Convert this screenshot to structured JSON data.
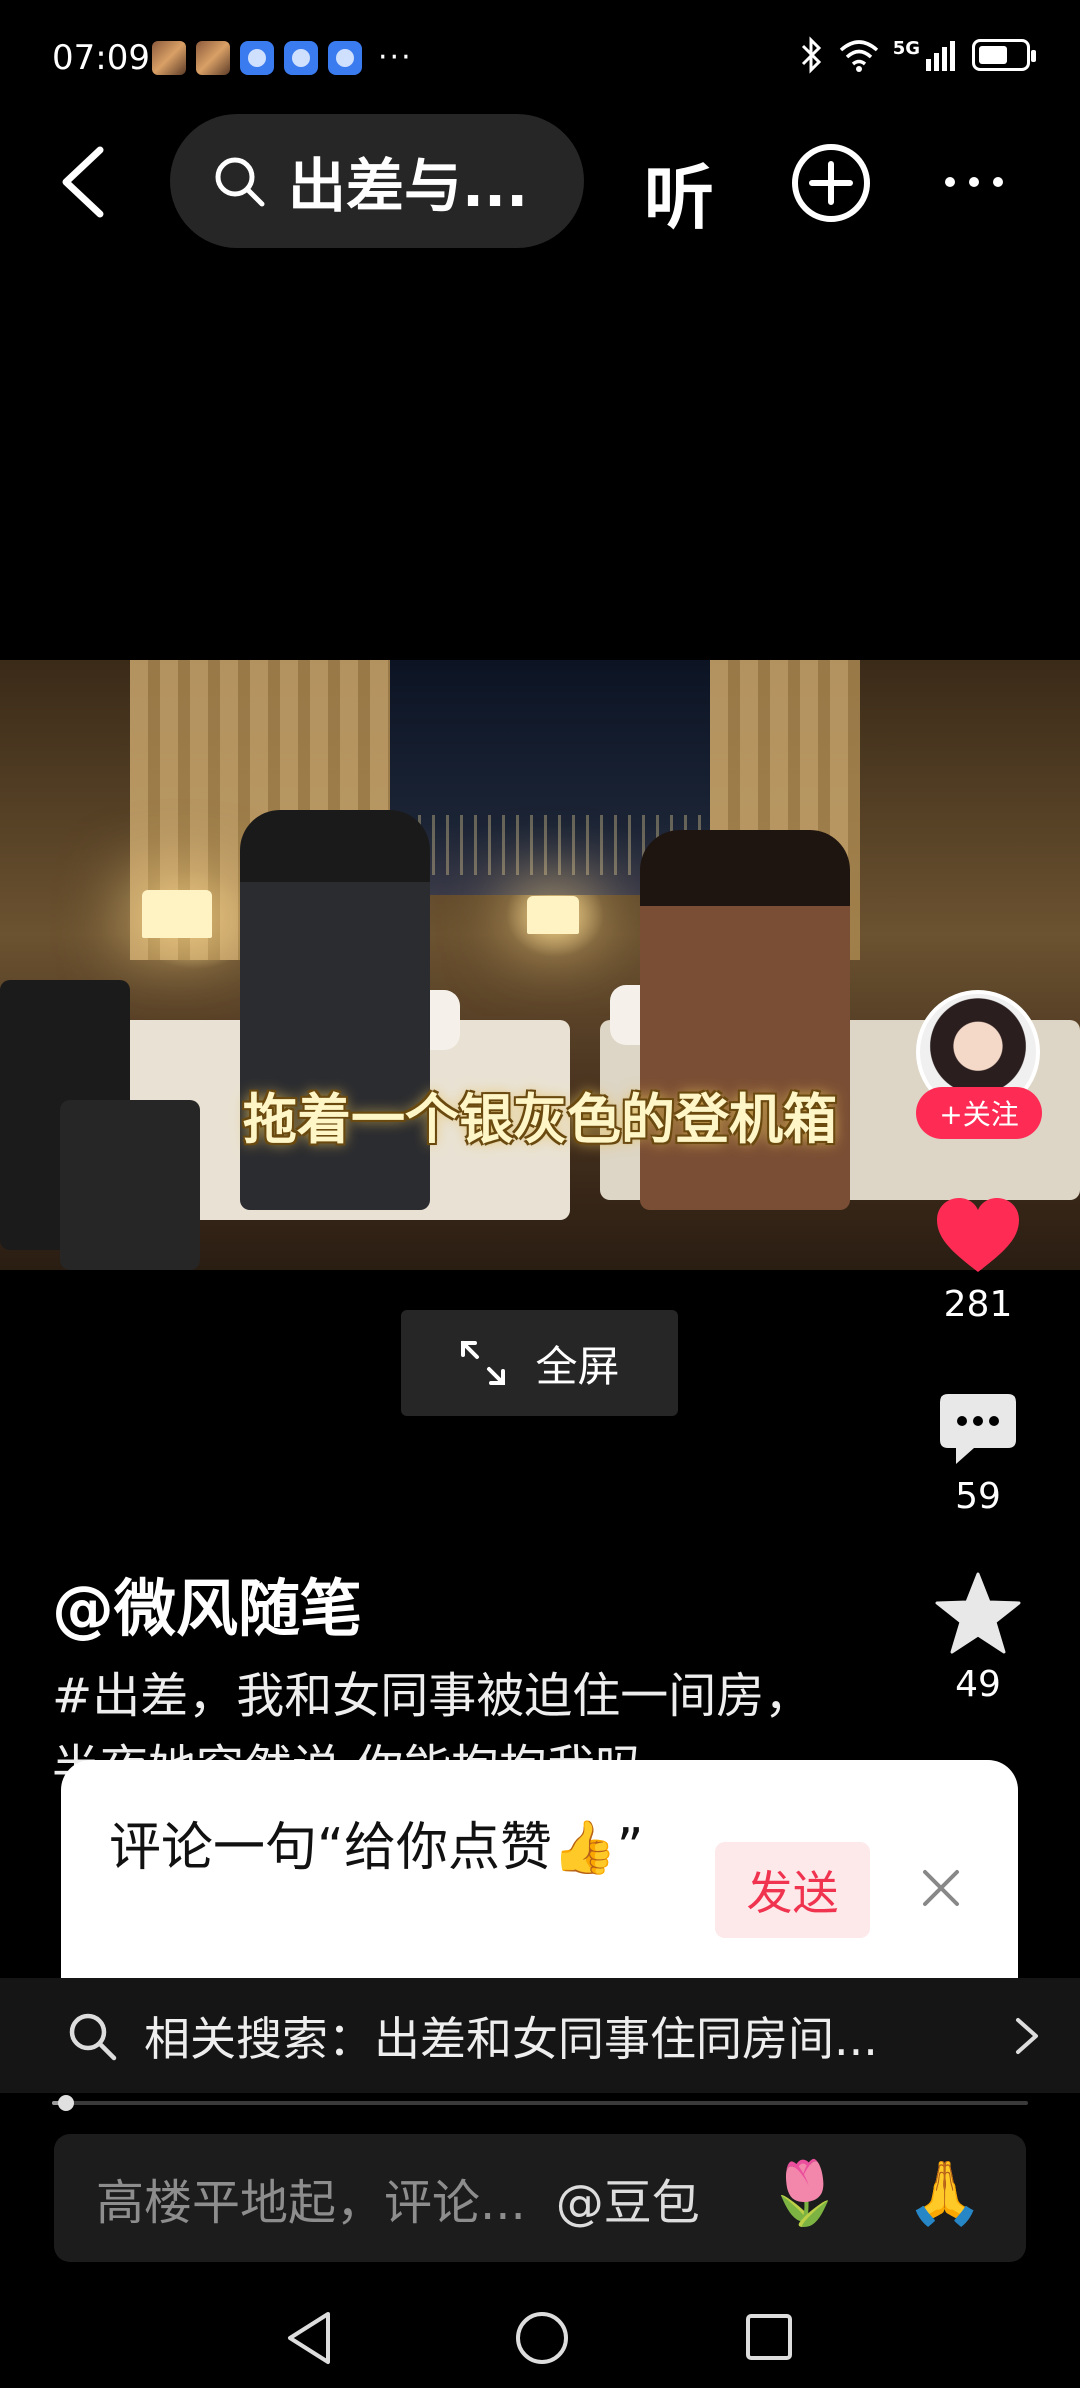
{
  "status_bar": {
    "time": "07:09",
    "network": "5G",
    "icons": [
      "notification-thumbnail-icon",
      "notification-thumbnail-icon",
      "app-notification-icon",
      "app-notification-icon",
      "app-notification-icon",
      "more-notifications-icon",
      "bluetooth-icon",
      "wifi-icon",
      "signal-icon",
      "battery-icon"
    ]
  },
  "nav": {
    "search_query": "出差与...",
    "listen_label": "听"
  },
  "video": {
    "subtitle": "拖着一个银灰色的登机箱",
    "fullscreen_label": "全屏"
  },
  "author": {
    "follow_label": "+关注",
    "name": "@微风随笔"
  },
  "actions": {
    "likes": "281",
    "comments": "59",
    "favorites": "49",
    "like_color": "#fe2c55"
  },
  "description": "#出差，我和女同事被迫住一间房，半夜她突然说 你能抱抱我吗",
  "popup": {
    "text": "评论一句“给你点赞👍”",
    "send_label": "发送"
  },
  "related": {
    "text": "相关搜索：出差和女同事住同房间..."
  },
  "progress": {
    "fraction": 0.014
  },
  "comment_bar": {
    "placeholder": "高楼平地起，评论...",
    "mention": "@豆包",
    "emoji_1": "🌷",
    "emoji_2": "🙏"
  }
}
